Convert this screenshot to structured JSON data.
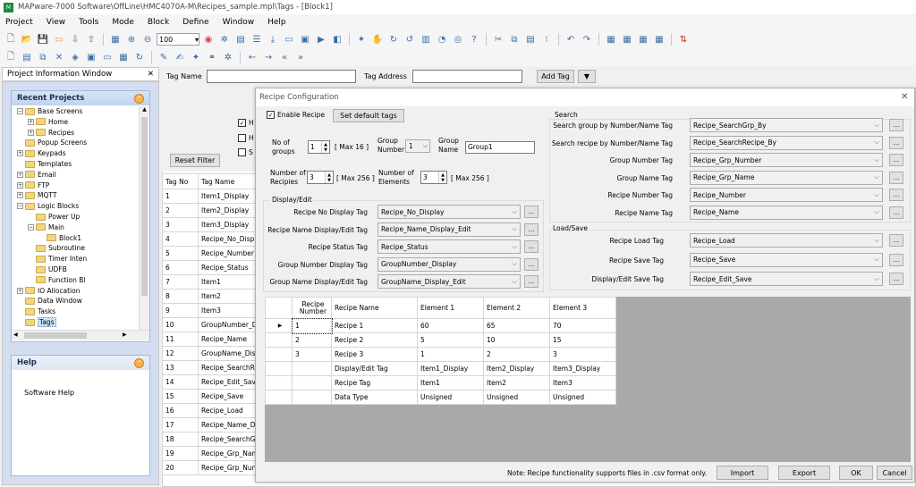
{
  "window": {
    "title": "MAPware-7000 Software\\OffLine\\HMC4070A-M\\Recipes_sample.mpl\\Tags - [Block1]",
    "app_icon": "app-logo-icon"
  },
  "menu": [
    "Project",
    "View",
    "Tools",
    "Mode",
    "Block",
    "Define",
    "Window",
    "Help"
  ],
  "toolbar": {
    "zoom": "100"
  },
  "project_window": {
    "title": "Project Information Window",
    "close": "✕"
  },
  "recent_projects": {
    "title": "Recent Projects",
    "items": [
      {
        "label": "Base Screens",
        "level": 1,
        "expand": "−"
      },
      {
        "label": "Home",
        "level": 2,
        "expand": "+"
      },
      {
        "label": "Recipes",
        "level": 2,
        "expand": "+"
      },
      {
        "label": "Popup Screens",
        "level": 1,
        "expand": ""
      },
      {
        "label": "Keypads",
        "level": 1,
        "expand": "+"
      },
      {
        "label": "Templates",
        "level": 1,
        "expand": ""
      },
      {
        "label": "Email",
        "level": 1,
        "expand": "+"
      },
      {
        "label": "FTP",
        "level": 1,
        "expand": "+"
      },
      {
        "label": "MQTT",
        "level": 1,
        "expand": "+"
      },
      {
        "label": "Logic Blocks",
        "level": 1,
        "expand": "−"
      },
      {
        "label": "Power Up",
        "level": 2,
        "expand": ""
      },
      {
        "label": "Main",
        "level": 2,
        "expand": "−"
      },
      {
        "label": "Block1",
        "level": 3,
        "expand": ""
      },
      {
        "label": "Subroutine",
        "level": 2,
        "expand": ""
      },
      {
        "label": "Timer Inten",
        "level": 2,
        "expand": ""
      },
      {
        "label": "UDFB",
        "level": 2,
        "expand": ""
      },
      {
        "label": "Function Bl",
        "level": 2,
        "expand": ""
      },
      {
        "label": "IO Allocation",
        "level": 1,
        "expand": "+"
      },
      {
        "label": "Data Window",
        "level": 1,
        "expand": ""
      },
      {
        "label": "Tasks",
        "level": 1,
        "expand": ""
      },
      {
        "label": "Tags",
        "level": 1,
        "expand": "",
        "selected": true
      }
    ]
  },
  "help": {
    "title": "Help",
    "link": "Software Help"
  },
  "tag_header": {
    "tag_name_label": "Tag Name",
    "tag_address_label": "Tag Address",
    "add_tag": "Add Tag",
    "reset_filter": "Reset Filter",
    "checks": [
      "H",
      "H",
      "S"
    ]
  },
  "tag_table": {
    "headers": [
      "Tag No",
      "Tag Name"
    ],
    "rows": [
      [
        "1",
        "Item1_Display"
      ],
      [
        "2",
        "Item2_Display"
      ],
      [
        "3",
        "Item3_Display"
      ],
      [
        "4",
        "Recipe_No_Disp"
      ],
      [
        "5",
        "Recipe_Number"
      ],
      [
        "6",
        "Recipe_Status"
      ],
      [
        "7",
        "Item1"
      ],
      [
        "8",
        "Item2"
      ],
      [
        "9",
        "Item3"
      ],
      [
        "10",
        "GroupNumber_Di"
      ],
      [
        "11",
        "Recipe_Name"
      ],
      [
        "12",
        "GroupName_Disp"
      ],
      [
        "13",
        "Recipe_SearchR"
      ],
      [
        "14",
        "Recipe_Edit_Sav"
      ],
      [
        "15",
        "Recipe_Save"
      ],
      [
        "16",
        "Recipe_Load"
      ],
      [
        "17",
        "Recipe_Name_D"
      ],
      [
        "18",
        "Recipe_SearchG"
      ],
      [
        "19",
        "Recipe_Grp_Nan"
      ],
      [
        "20",
        "Recipe_Grp_Nun"
      ]
    ]
  },
  "dialog": {
    "title": "Recipe Configuration",
    "close": "✕",
    "enable_recipe": "Enable Recipe",
    "set_default": "Set default tags",
    "no_groups_label": "No of groups",
    "no_groups_value": "1",
    "max16": "[ Max 16 ]",
    "group_number_label": "Group Number",
    "group_number_value": "1",
    "group_name_label": "Group Name",
    "group_name_value": "Group1",
    "num_recipes_label": "Number of Recipies",
    "num_recipes_value": "3",
    "max256a": "[ Max 256 ]",
    "num_elements_label": "Number of Elements",
    "num_elements_value": "3",
    "max256b": "[ Max 256 ]",
    "display_edit": {
      "legend": "Display/Edit",
      "rows": [
        {
          "label": "Recipe No Display Tag",
          "value": "Recipe_No_Display"
        },
        {
          "label": "Recipe Name Display/Edit Tag",
          "value": "Recipe_Name_Display_Edit"
        },
        {
          "label": "Recipe Status Tag",
          "value": "Recipe_Status"
        },
        {
          "label": "Group Number Display Tag",
          "value": "GroupNumber_Display"
        },
        {
          "label": "Group Name Display/Edit Tag",
          "value": "GroupName_Display_Edit"
        }
      ]
    },
    "search": {
      "legend": "Search",
      "rows": [
        {
          "label": "Search group by Number/Name Tag",
          "value": "Recipe_SearchGrp_By"
        },
        {
          "label": "Search recipe by Number/Name Tag",
          "value": "Recipe_SearchRecipe_By"
        },
        {
          "label": "Group Number Tag",
          "value": "Recipe_Grp_Number"
        },
        {
          "label": "Group Name Tag",
          "value": "Recipe_Grp_Name"
        },
        {
          "label": "Recipe Number Tag",
          "value": "Recipe_Number"
        },
        {
          "label": "Recipe Name Tag",
          "value": "Recipe_Name"
        }
      ]
    },
    "load_save": {
      "legend": "Load/Save",
      "rows": [
        {
          "label": "Recipe Load Tag",
          "value": "Recipe_Load"
        },
        {
          "label": "Recipe Save Tag",
          "value": "Recipe_Save"
        },
        {
          "label": "Display/Edit Save Tag",
          "value": "Recipe_Edit_Save"
        }
      ]
    },
    "grid": {
      "headers": [
        "Recipe Number",
        "Recipe Name",
        "Element 1",
        "Element 2",
        "Element 3"
      ],
      "rows": [
        [
          "1",
          "Recipe 1",
          "60",
          "65",
          "70"
        ],
        [
          "2",
          "Recipe 2",
          "5",
          "10",
          "15"
        ],
        [
          "3",
          "Recipe 3",
          "1",
          "2",
          "3"
        ],
        [
          "",
          "Display/Edit Tag",
          "Item1_Display",
          "Item2_Display",
          "Item3_Display"
        ],
        [
          "",
          "Recipe Tag",
          "Item1",
          "Item2",
          "Item3"
        ],
        [
          "",
          "Data Type",
          "Unsigned",
          "Unsigned",
          "Unsigned"
        ]
      ]
    },
    "note": "Note: Recipe functionality supports files in .csv format only.",
    "buttons": {
      "import": "Import",
      "export": "Export",
      "ok": "OK",
      "cancel": "Cancel"
    }
  }
}
